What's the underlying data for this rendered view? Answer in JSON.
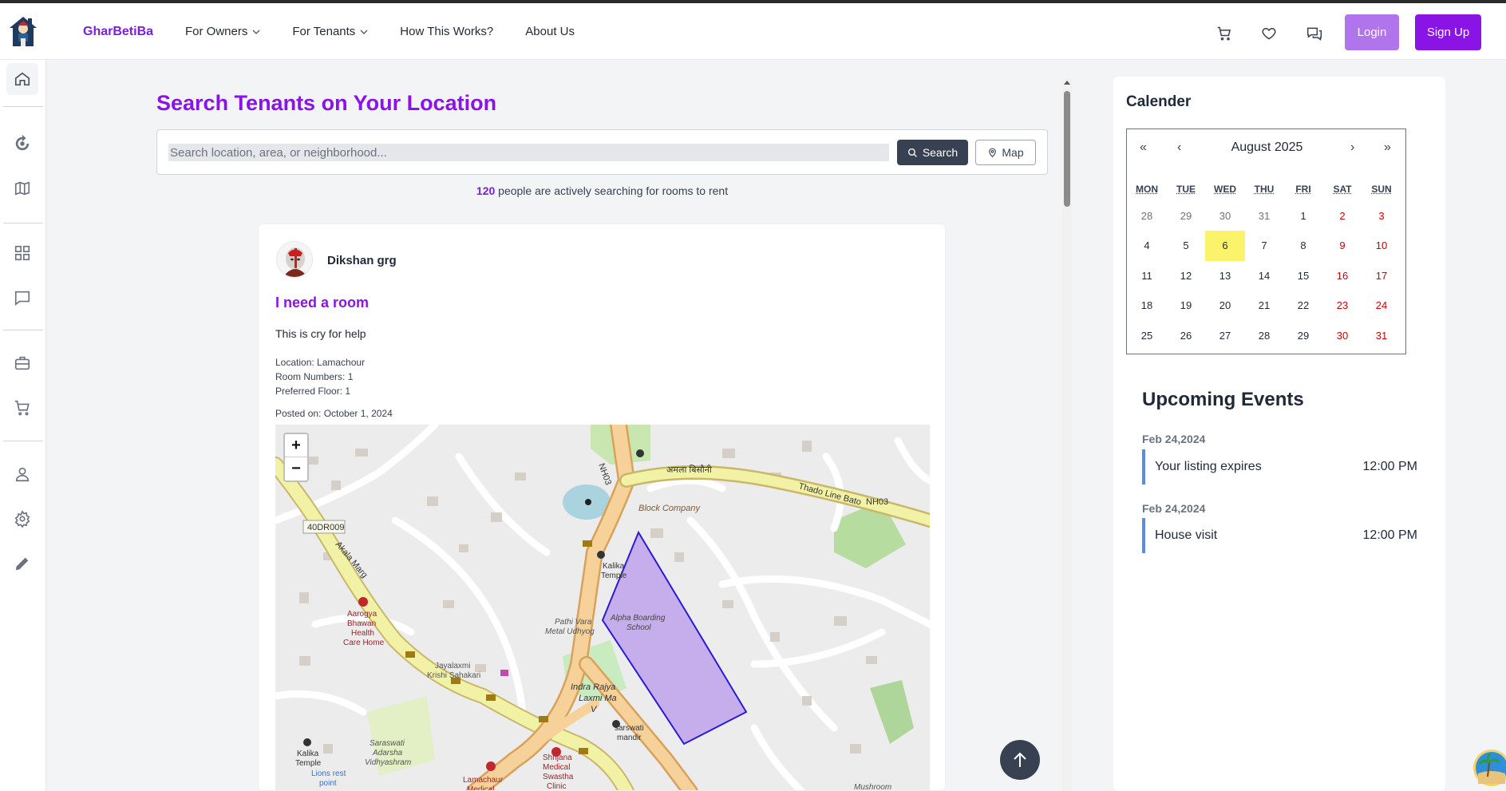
{
  "header": {
    "brand": "GharBetiBa",
    "nav": [
      {
        "label": "For Owners",
        "dropdown": true
      },
      {
        "label": "For Tenants",
        "dropdown": true
      },
      {
        "label": "How This Works?",
        "dropdown": false
      },
      {
        "label": "About Us",
        "dropdown": false
      }
    ],
    "icons": [
      "cart-icon",
      "heart-icon",
      "chat-icon"
    ],
    "login_label": "Login",
    "signup_label": "Sign Up"
  },
  "sidebar": {
    "items": [
      "home-icon",
      "refresh-icon",
      "map-icon",
      "dashboard-icon",
      "message-icon",
      "briefcase-icon",
      "cart-icon",
      "user-icon",
      "settings-icon",
      "edit-icon"
    ]
  },
  "main": {
    "title": "Search Tenants on Your Location",
    "search_placeholder": "Search location, area, or neighborhood...",
    "search_button": "Search",
    "map_button": "Map",
    "searching_count": "120",
    "searching_text": "people are actively searching for rooms to rent"
  },
  "post": {
    "author": "Dikshan grg",
    "title": "I need a room",
    "body": "This is cry for help",
    "location": "Location: Lamachour",
    "rooms": "Room Numbers: 1",
    "floor": "Preferred Floor: 1",
    "posted": "Posted on: October 1, 2024"
  },
  "map": {
    "zoom_in": "+",
    "zoom_out": "−",
    "labels": [
      "40DR009",
      "Akala Marg",
      "NH03",
      "अमला बिसौनी",
      "Thado Line Bato",
      "NH03",
      "Block Company",
      "Kalika Temple",
      "Pathi Vara Metal Udhyog",
      "Alpha Boarding School",
      "Aarogya Bhawan Health Care Home",
      "Jayalaxmi Krishi Sahakari",
      "Indra Rajya Laxmi Ma V",
      "sarswati mandir",
      "Saraswati Adarsha Vidhyashram",
      "Kalika Temple",
      "Lions rest point",
      "Shrijana Medical Swastha Clinic",
      "Lamachaur Medical",
      "Mushroom"
    ]
  },
  "calendar": {
    "heading": "Calender",
    "month": "August 2025",
    "nav": {
      "prev_year": "«",
      "prev": "‹",
      "next": "›",
      "next_year": "»"
    },
    "weekdays": [
      "MON",
      "TUE",
      "WED",
      "THU",
      "FRI",
      "SAT",
      "SUN"
    ],
    "weeks": [
      [
        "28",
        "29",
        "30",
        "31",
        "1",
        "2",
        "3"
      ],
      [
        "4",
        "5",
        "6",
        "7",
        "8",
        "9",
        "10"
      ],
      [
        "11",
        "12",
        "13",
        "14",
        "15",
        "16",
        "17"
      ],
      [
        "18",
        "19",
        "20",
        "21",
        "22",
        "23",
        "24"
      ],
      [
        "25",
        "26",
        "27",
        "28",
        "29",
        "30",
        "31"
      ]
    ],
    "today": "6"
  },
  "events": {
    "heading": "Upcoming Events",
    "items": [
      {
        "date": "Feb 24,2024",
        "title": "Your listing expires",
        "time": "12:00 PM"
      },
      {
        "date": "Feb 24,2024",
        "title": "House visit",
        "time": "12:00 PM"
      }
    ]
  },
  "colors": {
    "brand": "#8a14e6",
    "login": "#b074ec",
    "today": "#fbf46a",
    "weekend": "#d10000",
    "event_bar": "#5a8de0"
  }
}
